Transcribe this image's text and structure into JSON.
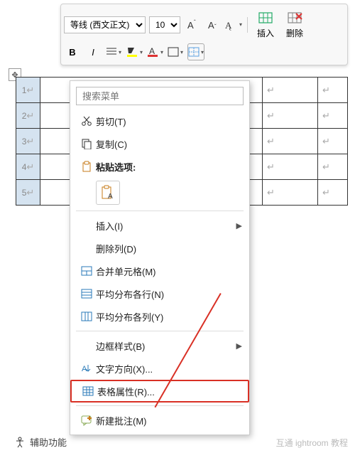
{
  "toolbar": {
    "font_name": "等线 (西文正文)",
    "font_size": "10",
    "insert_label": "插入",
    "delete_label": "删除"
  },
  "table": {
    "rows": [
      "1",
      "2",
      "3",
      "4",
      "5"
    ]
  },
  "menu": {
    "search_placeholder": "搜索菜单",
    "cut": "剪切(T)",
    "copy": "复制(C)",
    "paste_options": "粘贴选项:",
    "insert": "插入(I)",
    "delete_col": "删除列(D)",
    "merge": "合并单元格(M)",
    "dist_rows": "平均分布各行(N)",
    "dist_cols": "平均分布各列(Y)",
    "border_style": "边框样式(B)",
    "text_direction": "文字方向(X)...",
    "table_props": "表格属性(R)...",
    "new_comment": "新建批注(M)"
  },
  "footer": {
    "accessibility": "辅助功能"
  },
  "watermark": "互通 ightroom 教程"
}
